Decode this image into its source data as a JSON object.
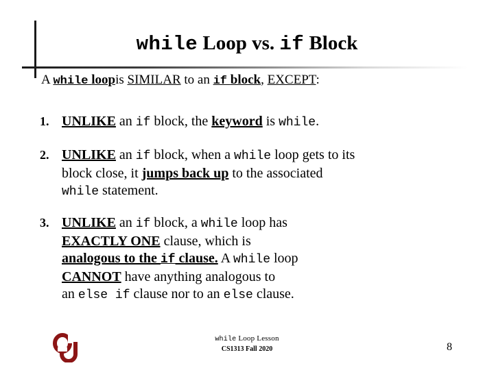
{
  "slide": {
    "title": {
      "part1_mono": "while",
      "part2": "Loop vs.",
      "part3_mono": "if",
      "part4": "Block"
    },
    "lead": {
      "a": "A",
      "while_mono": "while",
      "loop": "loop",
      "is": "is",
      "similar": "SIMILAR",
      "to_an": "to an",
      "if_mono": "if",
      "block": "block",
      "comma": ",",
      "except": "EXCEPT",
      "colon": ":"
    },
    "items": [
      {
        "number": "1.",
        "lines": [
          {
            "segments": [
              {
                "text": "UNLIKE",
                "style": "bold-underline"
              },
              {
                "text": " an ",
                "style": "plain"
              },
              {
                "text": "if",
                "style": "mono"
              },
              {
                "text": " block, the ",
                "style": "plain"
              },
              {
                "text": "keyword",
                "style": "bold-underline"
              },
              {
                "text": " is ",
                "style": "plain"
              },
              {
                "text": "while",
                "style": "mono"
              },
              {
                "text": ".",
                "style": "plain"
              }
            ]
          }
        ]
      },
      {
        "number": "2.",
        "lines": [
          {
            "segments": [
              {
                "text": "UNLIKE",
                "style": "bold-underline"
              },
              {
                "text": " an ",
                "style": "plain"
              },
              {
                "text": "if",
                "style": "mono"
              },
              {
                "text": " block, when a ",
                "style": "plain"
              },
              {
                "text": "while",
                "style": "mono"
              },
              {
                "text": " loop gets to  its",
                "style": "plain"
              }
            ]
          },
          {
            "segments": [
              {
                "text": "block close, it ",
                "style": "plain"
              },
              {
                "text": "jumps back up",
                "style": "bold-underline"
              },
              {
                "text": " to the associated",
                "style": "plain"
              }
            ]
          },
          {
            "segments": [
              {
                "text": "while",
                "style": "mono"
              },
              {
                "text": " statement.",
                "style": "plain"
              }
            ]
          }
        ]
      },
      {
        "number": "3.",
        "lines": [
          {
            "segments": [
              {
                "text": "UNLIKE",
                "style": "bold-underline"
              },
              {
                "text": " an ",
                "style": "plain"
              },
              {
                "text": "if",
                "style": "mono"
              },
              {
                "text": " block, a ",
                "style": "plain"
              },
              {
                "text": "while",
                "style": "mono"
              },
              {
                "text": " loop has",
                "style": "plain"
              }
            ]
          },
          {
            "segments": [
              {
                "text": "EXACTLY ONE",
                "style": "bold-underline"
              },
              {
                "text": " clause, which is",
                "style": "plain"
              }
            ]
          },
          {
            "segments": [
              {
                "text": "analogous to the ",
                "style": "bold-underline"
              },
              {
                "text": "if",
                "style": "mono-bold-underline"
              },
              {
                "text": " clause.",
                "style": "bold-underline"
              },
              {
                "text": " A ",
                "style": "plain"
              },
              {
                "text": "while",
                "style": "mono"
              },
              {
                "text": " loop",
                "style": "plain"
              }
            ]
          },
          {
            "segments": [
              {
                "text": "CANNOT",
                "style": "bold-underline"
              },
              {
                "text": " have anything analogous to",
                "style": "plain"
              }
            ]
          },
          {
            "segments": [
              {
                "text": "an ",
                "style": "plain"
              },
              {
                "text": "else if",
                "style": "mono"
              },
              {
                "text": " clause nor to an ",
                "style": "plain"
              },
              {
                "text": "else",
                "style": "mono"
              },
              {
                "text": " clause.",
                "style": "plain"
              }
            ]
          }
        ]
      }
    ],
    "footer": {
      "lesson_mono": "while",
      "lesson_rest": "Loop Lesson",
      "course": "CS1313 Fall 2020",
      "page_number": "8",
      "logo_name": "ou-logo",
      "logo_color": "#8C1515"
    },
    "colors": {
      "background": "#ffffff",
      "text": "#000000",
      "rule": "#1a1a1a",
      "crimson": "#8C1515"
    }
  }
}
